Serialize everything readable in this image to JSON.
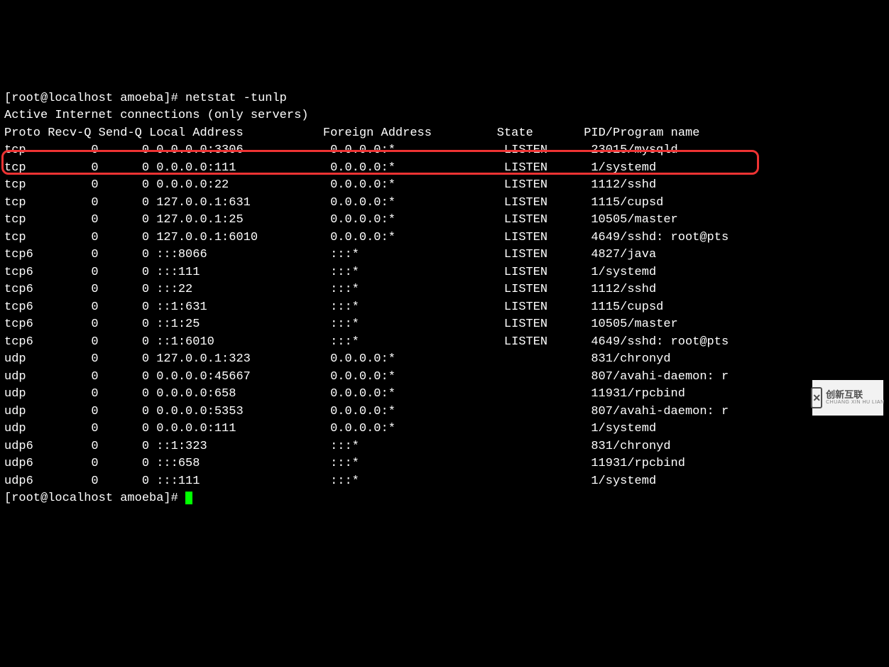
{
  "prompt1": "[root@localhost amoeba]# ",
  "command": "netstat -tunlp",
  "header_line": "Active Internet connections (only servers)",
  "columns": {
    "proto": "Proto",
    "recvq": "Recv-Q",
    "sendq": "Send-Q",
    "local": "Local Address",
    "foreign": "Foreign Address",
    "state": "State",
    "pid": "PID/Program name"
  },
  "rows": [
    {
      "proto": "tcp",
      "recvq": "0",
      "sendq": "0",
      "local": "0.0.0.0:3306",
      "foreign": "0.0.0.0:*",
      "state": "LISTEN",
      "pid": "23015/mysqld"
    },
    {
      "proto": "tcp",
      "recvq": "0",
      "sendq": "0",
      "local": "0.0.0.0:111",
      "foreign": "0.0.0.0:*",
      "state": "LISTEN",
      "pid": "1/systemd"
    },
    {
      "proto": "tcp",
      "recvq": "0",
      "sendq": "0",
      "local": "0.0.0.0:22",
      "foreign": "0.0.0.0:*",
      "state": "LISTEN",
      "pid": "1112/sshd"
    },
    {
      "proto": "tcp",
      "recvq": "0",
      "sendq": "0",
      "local": "127.0.0.1:631",
      "foreign": "0.0.0.0:*",
      "state": "LISTEN",
      "pid": "1115/cupsd"
    },
    {
      "proto": "tcp",
      "recvq": "0",
      "sendq": "0",
      "local": "127.0.0.1:25",
      "foreign": "0.0.0.0:*",
      "state": "LISTEN",
      "pid": "10505/master"
    },
    {
      "proto": "tcp",
      "recvq": "0",
      "sendq": "0",
      "local": "127.0.0.1:6010",
      "foreign": "0.0.0.0:*",
      "state": "LISTEN",
      "pid": "4649/sshd: root@pts"
    },
    {
      "proto": "tcp6",
      "recvq": "0",
      "sendq": "0",
      "local": ":::8066",
      "foreign": ":::*",
      "state": "LISTEN",
      "pid": "4827/java"
    },
    {
      "proto": "tcp6",
      "recvq": "0",
      "sendq": "0",
      "local": ":::111",
      "foreign": ":::*",
      "state": "LISTEN",
      "pid": "1/systemd"
    },
    {
      "proto": "tcp6",
      "recvq": "0",
      "sendq": "0",
      "local": ":::22",
      "foreign": ":::*",
      "state": "LISTEN",
      "pid": "1112/sshd"
    },
    {
      "proto": "tcp6",
      "recvq": "0",
      "sendq": "0",
      "local": "::1:631",
      "foreign": ":::*",
      "state": "LISTEN",
      "pid": "1115/cupsd"
    },
    {
      "proto": "tcp6",
      "recvq": "0",
      "sendq": "0",
      "local": "::1:25",
      "foreign": ":::*",
      "state": "LISTEN",
      "pid": "10505/master"
    },
    {
      "proto": "tcp6",
      "recvq": "0",
      "sendq": "0",
      "local": "::1:6010",
      "foreign": ":::*",
      "state": "LISTEN",
      "pid": "4649/sshd: root@pts"
    },
    {
      "proto": "udp",
      "recvq": "0",
      "sendq": "0",
      "local": "127.0.0.1:323",
      "foreign": "0.0.0.0:*",
      "state": "",
      "pid": "831/chronyd"
    },
    {
      "proto": "udp",
      "recvq": "0",
      "sendq": "0",
      "local": "0.0.0.0:45667",
      "foreign": "0.0.0.0:*",
      "state": "",
      "pid": "807/avahi-daemon: r"
    },
    {
      "proto": "udp",
      "recvq": "0",
      "sendq": "0",
      "local": "0.0.0.0:658",
      "foreign": "0.0.0.0:*",
      "state": "",
      "pid": "11931/rpcbind"
    },
    {
      "proto": "udp",
      "recvq": "0",
      "sendq": "0",
      "local": "0.0.0.0:5353",
      "foreign": "0.0.0.0:*",
      "state": "",
      "pid": "807/avahi-daemon: r"
    },
    {
      "proto": "udp",
      "recvq": "0",
      "sendq": "0",
      "local": "0.0.0.0:111",
      "foreign": "0.0.0.0:*",
      "state": "",
      "pid": "1/systemd"
    },
    {
      "proto": "udp6",
      "recvq": "0",
      "sendq": "0",
      "local": "::1:323",
      "foreign": ":::*",
      "state": "",
      "pid": "831/chronyd"
    },
    {
      "proto": "udp6",
      "recvq": "0",
      "sendq": "0",
      "local": ":::658",
      "foreign": ":::*",
      "state": "",
      "pid": "11931/rpcbind"
    },
    {
      "proto": "udp6",
      "recvq": "0",
      "sendq": "0",
      "local": ":::111",
      "foreign": ":::*",
      "state": "",
      "pid": "1/systemd"
    }
  ],
  "prompt2": "[root@localhost amoeba]# ",
  "watermark": {
    "top": "创新互联",
    "bot": "CHUANG XIN HU LIAN"
  }
}
